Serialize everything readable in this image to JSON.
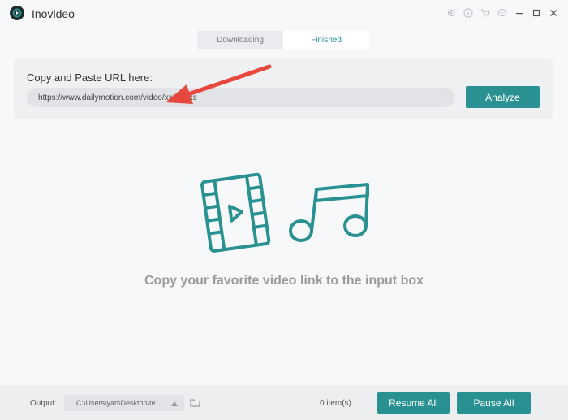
{
  "app": {
    "title": "Inovideo"
  },
  "tabs": [
    {
      "label": "Downloading",
      "active": false
    },
    {
      "label": "Finished",
      "active": true
    }
  ],
  "url_panel": {
    "label": "Copy and Paste URL here:",
    "input_value": "https://www.dailymotion.com/video/xxxxxxxs",
    "analyze_label": "Analyze"
  },
  "empty_state": {
    "message": "Copy your favorite video link to the input box"
  },
  "bottom_bar": {
    "output_label": "Output:",
    "output_path": "C:\\Users\\yan\\Desktop\\te...",
    "items_count": "0 item(s)",
    "resume_label": "Resume All",
    "pause_label": "Pause All"
  },
  "titlebar_icons": [
    "settings-icon",
    "info-icon",
    "cart-icon",
    "feedback-icon",
    "minimize-icon",
    "maximize-icon",
    "close-icon"
  ],
  "colors": {
    "accent": "#2a9192",
    "annotation": "#e8473d",
    "empty_text": "#9a9a9a"
  }
}
